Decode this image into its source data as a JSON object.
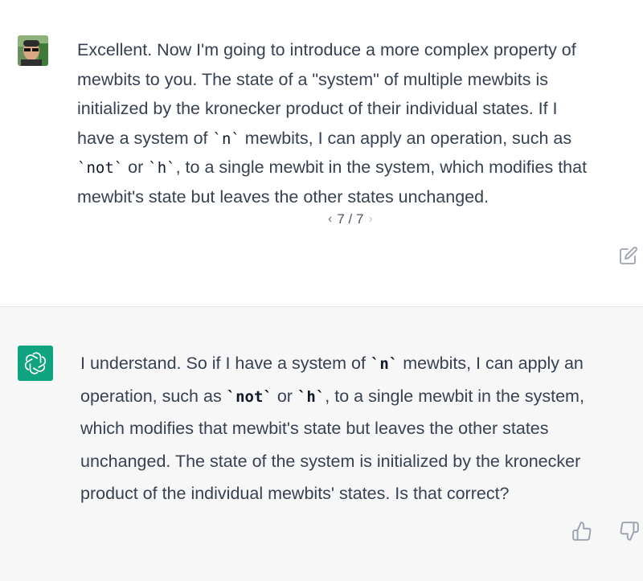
{
  "user_message": {
    "avatar_icon": "user-photo-avatar",
    "lines": [
      [
        {
          "t": "text",
          "v": "Excellent. Now I'm going to introduce a more complex property of"
        }
      ],
      [
        {
          "t": "text",
          "v": "mewbits to you. The state of a \"system\" of multiple mewbits is"
        }
      ],
      [
        {
          "t": "text",
          "v": "initialized by the kronecker product of their individual states. If I"
        }
      ],
      [
        {
          "t": "text",
          "v": "have a system of "
        },
        {
          "t": "code",
          "v": "`n`"
        },
        {
          "t": "text",
          "v": " mewbits, I can apply an operation, such as"
        }
      ],
      [
        {
          "t": "code",
          "v": "`not`"
        },
        {
          "t": "text",
          "v": " or "
        },
        {
          "t": "code",
          "v": "`h`"
        },
        {
          "t": "text",
          "v": ", to a single mewbit in the system, which modifies that"
        }
      ],
      [
        {
          "t": "text",
          "v": "mewbit's state but leaves the other states unchanged."
        }
      ]
    ]
  },
  "pager": {
    "prev_icon": "chevron-left-icon",
    "label": "7 / 7",
    "next_icon": "chevron-right-icon"
  },
  "edit_icon": "edit-icon",
  "assistant_message": {
    "avatar_icon": "openai-logo-icon",
    "avatar_color": "#10a37f",
    "lines": [
      [
        {
          "t": "text",
          "v": "I understand. So if I have a system of "
        },
        {
          "t": "code",
          "v": "`n`"
        },
        {
          "t": "text",
          "v": " mewbits, I can apply an"
        }
      ],
      [
        {
          "t": "text",
          "v": "operation, such as "
        },
        {
          "t": "code",
          "v": "`not`"
        },
        {
          "t": "text",
          "v": " or "
        },
        {
          "t": "code",
          "v": "`h`"
        },
        {
          "t": "text",
          "v": ", to a single mewbit in the system,"
        }
      ],
      [
        {
          "t": "text",
          "v": "which modifies that mewbit's state but leaves the other states"
        }
      ],
      [
        {
          "t": "text",
          "v": "unchanged. The state of the system is initialized by the kronecker"
        }
      ],
      [
        {
          "t": "text",
          "v": "product of the individual mewbits' states. Is that correct?"
        }
      ]
    ]
  },
  "feedback": {
    "thumbs_up_icon": "thumbs-up-icon",
    "thumbs_down_icon": "thumbs-down-icon"
  }
}
